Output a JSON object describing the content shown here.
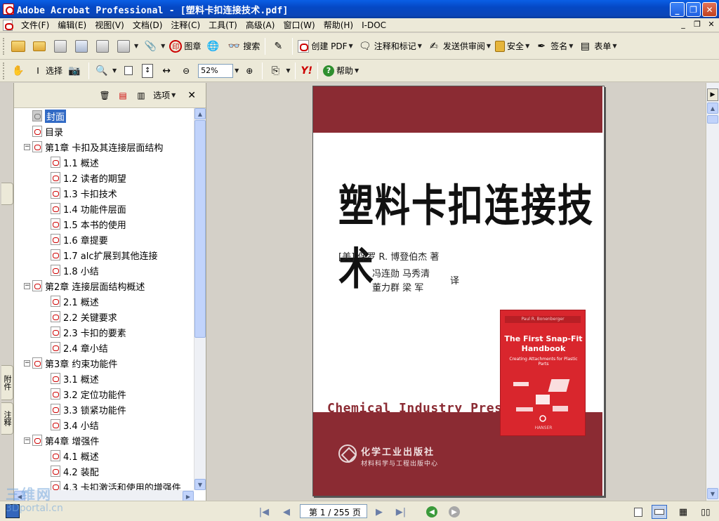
{
  "window": {
    "title": "Adobe Acrobat Professional - [塑料卡扣连接技术.pdf]",
    "minimize_label": "_",
    "maximize_label": "❐",
    "close_label": "✕"
  },
  "menu": {
    "items": [
      "文件(F)",
      "编辑(E)",
      "视图(V)",
      "文档(D)",
      "注释(C)",
      "工具(T)",
      "高级(A)",
      "窗口(W)",
      "帮助(H)",
      "I-DOC"
    ],
    "mdi_minimize": "_",
    "mdi_restore": "❐",
    "mdi_close": "✕"
  },
  "toolbar1": {
    "stamp_label": "图章",
    "search_label": "搜索",
    "create_pdf_label": "创建 PDF",
    "comment_label": "注释和标记",
    "review_label": "发送供审阅",
    "security_label": "安全",
    "sign_label": "签名",
    "forms_label": "表单",
    "stamp_glyph": "印"
  },
  "toolbar2": {
    "select_label": "选择",
    "zoom_value": "52%",
    "help_label": "帮助",
    "yahoo_label": "Y!"
  },
  "side_tabs": {
    "attachments": "附件",
    "comments": "注释"
  },
  "bookmarks": {
    "options_label": "选项",
    "close_label": "✕",
    "items": [
      {
        "label": "封面",
        "level": 0,
        "expander": "",
        "selected": true,
        "gray": true
      },
      {
        "label": "目录",
        "level": 0,
        "expander": ""
      },
      {
        "label": "第1章 卡扣及其连接层面结构",
        "level": 0,
        "expander": "−"
      },
      {
        "label": "1.1 概述",
        "level": 1,
        "expander": ""
      },
      {
        "label": "1.2 读者的期望",
        "level": 1,
        "expander": ""
      },
      {
        "label": "1.3 卡扣技术",
        "level": 1,
        "expander": ""
      },
      {
        "label": "1.4 功能件层面",
        "level": 1,
        "expander": ""
      },
      {
        "label": "1.5 本书的使用",
        "level": 1,
        "expander": ""
      },
      {
        "label": "1.6 章提要",
        "level": 1,
        "expander": ""
      },
      {
        "label": "1.7 alc扩展到其他连接",
        "level": 1,
        "expander": ""
      },
      {
        "label": "1.8 小结",
        "level": 1,
        "expander": ""
      },
      {
        "label": "第2章 连接层面结构概述",
        "level": 0,
        "expander": "−"
      },
      {
        "label": "2.1 概述",
        "level": 1,
        "expander": ""
      },
      {
        "label": "2.2 关键要求",
        "level": 1,
        "expander": ""
      },
      {
        "label": "2.3 卡扣的要素",
        "level": 1,
        "expander": ""
      },
      {
        "label": "2.4 章小结",
        "level": 1,
        "expander": ""
      },
      {
        "label": "第3章 约束功能件",
        "level": 0,
        "expander": "−"
      },
      {
        "label": "3.1 概述",
        "level": 1,
        "expander": ""
      },
      {
        "label": "3.2 定位功能件",
        "level": 1,
        "expander": ""
      },
      {
        "label": "3.3 锁紧功能件",
        "level": 1,
        "expander": ""
      },
      {
        "label": "3.4 小结",
        "level": 1,
        "expander": ""
      },
      {
        "label": "第4章 增强件",
        "level": 0,
        "expander": "−"
      },
      {
        "label": "4.1 概述",
        "level": 1,
        "expander": ""
      },
      {
        "label": "4.2 装配",
        "level": 1,
        "expander": ""
      },
      {
        "label": "4.3 卡扣激活和使用的增强件",
        "level": 1,
        "expander": ""
      }
    ]
  },
  "document": {
    "cover_title": "塑料卡扣连接技术",
    "author_line": "[美] 保罗 R. 博登伯杰 著",
    "translators_line1": "冯连勋 马秀清",
    "translators_line2": "董力群 梁 军",
    "translate_mark": "译",
    "press_en": "Chemical Industry Press",
    "press_cn": "化学工业出版社",
    "press_center": "材料科学与工程出版中心",
    "orig_author": "Paul R. Bonenberger",
    "orig_title": "The First Snap-Fit Handbook",
    "orig_subtitle": "Creating Attachments for Plastic Parts",
    "orig_publisher": "HANSER"
  },
  "navigation": {
    "page_display": "第 1 / 255 页",
    "first_glyph": "|◀",
    "prev_glyph": "◀",
    "next_glyph": "▶",
    "last_glyph": "▶|",
    "back_glyph": "◀",
    "forward_glyph": "▶"
  },
  "watermark": {
    "line1": "三维网",
    "line2": "3Dportal.cn"
  }
}
